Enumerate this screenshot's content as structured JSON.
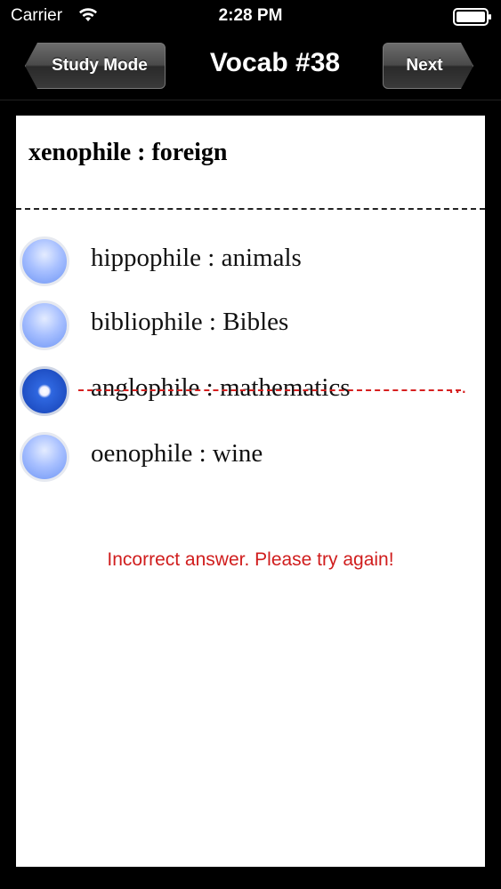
{
  "status_bar": {
    "carrier": "Carrier",
    "time": "2:28 PM",
    "icons": [
      "wifi-icon",
      "battery-icon"
    ]
  },
  "nav": {
    "back_label": "Study Mode",
    "title": "Vocab #38",
    "next_label": "Next"
  },
  "question": {
    "prompt": "xenophile : foreign"
  },
  "options": [
    {
      "label": "hippophile : animals",
      "selected": false,
      "incorrect": false
    },
    {
      "label": "bibliophile : Bibles",
      "selected": false,
      "incorrect": false
    },
    {
      "label": "anglophile : mathematics",
      "selected": true,
      "incorrect": true
    },
    {
      "label": "oenophile : wine",
      "selected": false,
      "incorrect": false
    }
  ],
  "feedback": {
    "message": "Incorrect answer. Please try again!",
    "color": "#d01d1d"
  },
  "colors": {
    "background": "#000000",
    "card": "#ffffff",
    "error": "#d62020"
  }
}
